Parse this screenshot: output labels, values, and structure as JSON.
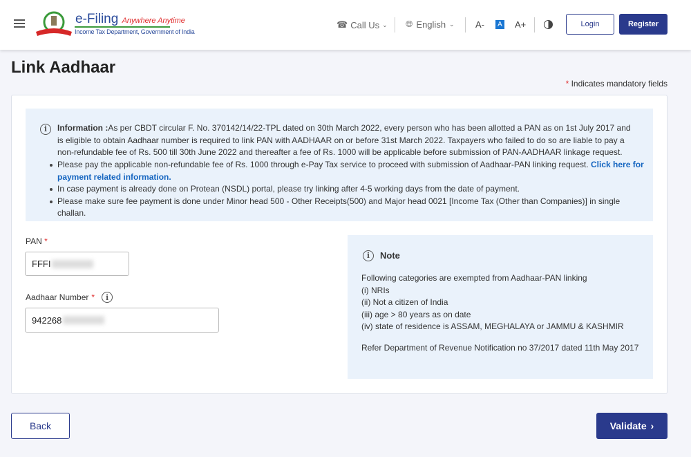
{
  "header": {
    "brand_title": "e-Filing",
    "brand_tagline": "Anywhere Anytime",
    "brand_subtitle": "Income Tax Department, Government of India",
    "call_us": "Call Us",
    "language": "English",
    "font_decrease": "A-",
    "font_normal": "A",
    "font_increase": "A+",
    "login": "Login",
    "register": "Register",
    "accent": "#2a3a8c"
  },
  "page": {
    "title": "Link Aadhaar",
    "mandatory_star": "*",
    "mandatory_note": "Indicates mandatory fields"
  },
  "info": {
    "label": "Information :",
    "text": "As per CBDT circular F. No. 370142/14/22-TPL dated on 30th March 2022, every person who has been allotted a PAN as on 1st July 2017 and is eligible to obtain Aadhaar number is required to link PAN with AADHAAR on or before 31st March 2022. Taxpayers who failed to do so are liable to pay a non-refundable fee of Rs. 500 till 30th June 2022 and thereafter a fee of Rs. 1000 will be applicable before submission of PAN-AADHAAR linkage request.",
    "bullets": [
      "Please pay the applicable non-refundable fee of Rs. 1000 through e-Pay Tax service to proceed with submission of Aadhaar-PAN linking request. Click here for payment related information.",
      "In case payment is already done on Protean (NSDL) portal, please try linking after 4-5 working days from the date of payment.",
      "Please make sure fee payment is done under Minor head 500 - Other Receipts(500) and Major head 0021 [Income Tax (Other than Companies)] in single challan."
    ],
    "link": "Click here for payment related information."
  },
  "form": {
    "pan_label": "PAN",
    "pan_value": "FFFI",
    "aadhaar_label": "Aadhaar Number",
    "aadhaar_value": "942268",
    "star": "*"
  },
  "note": {
    "title": "Note",
    "intro": "Following categories are exempted from Aadhaar-PAN linking",
    "items": [
      "(i) NRIs",
      "(ii) Not a citizen of India",
      "(iii) age > 80 years as on date",
      "(iv) state of residence is ASSAM, MEGHALAYA or JAMMU & KASHMIR"
    ],
    "refer": "Refer Department of Revenue Notification no 37/2017 dated 11th May 2017"
  },
  "actions": {
    "back": "Back",
    "validate": "Validate"
  }
}
